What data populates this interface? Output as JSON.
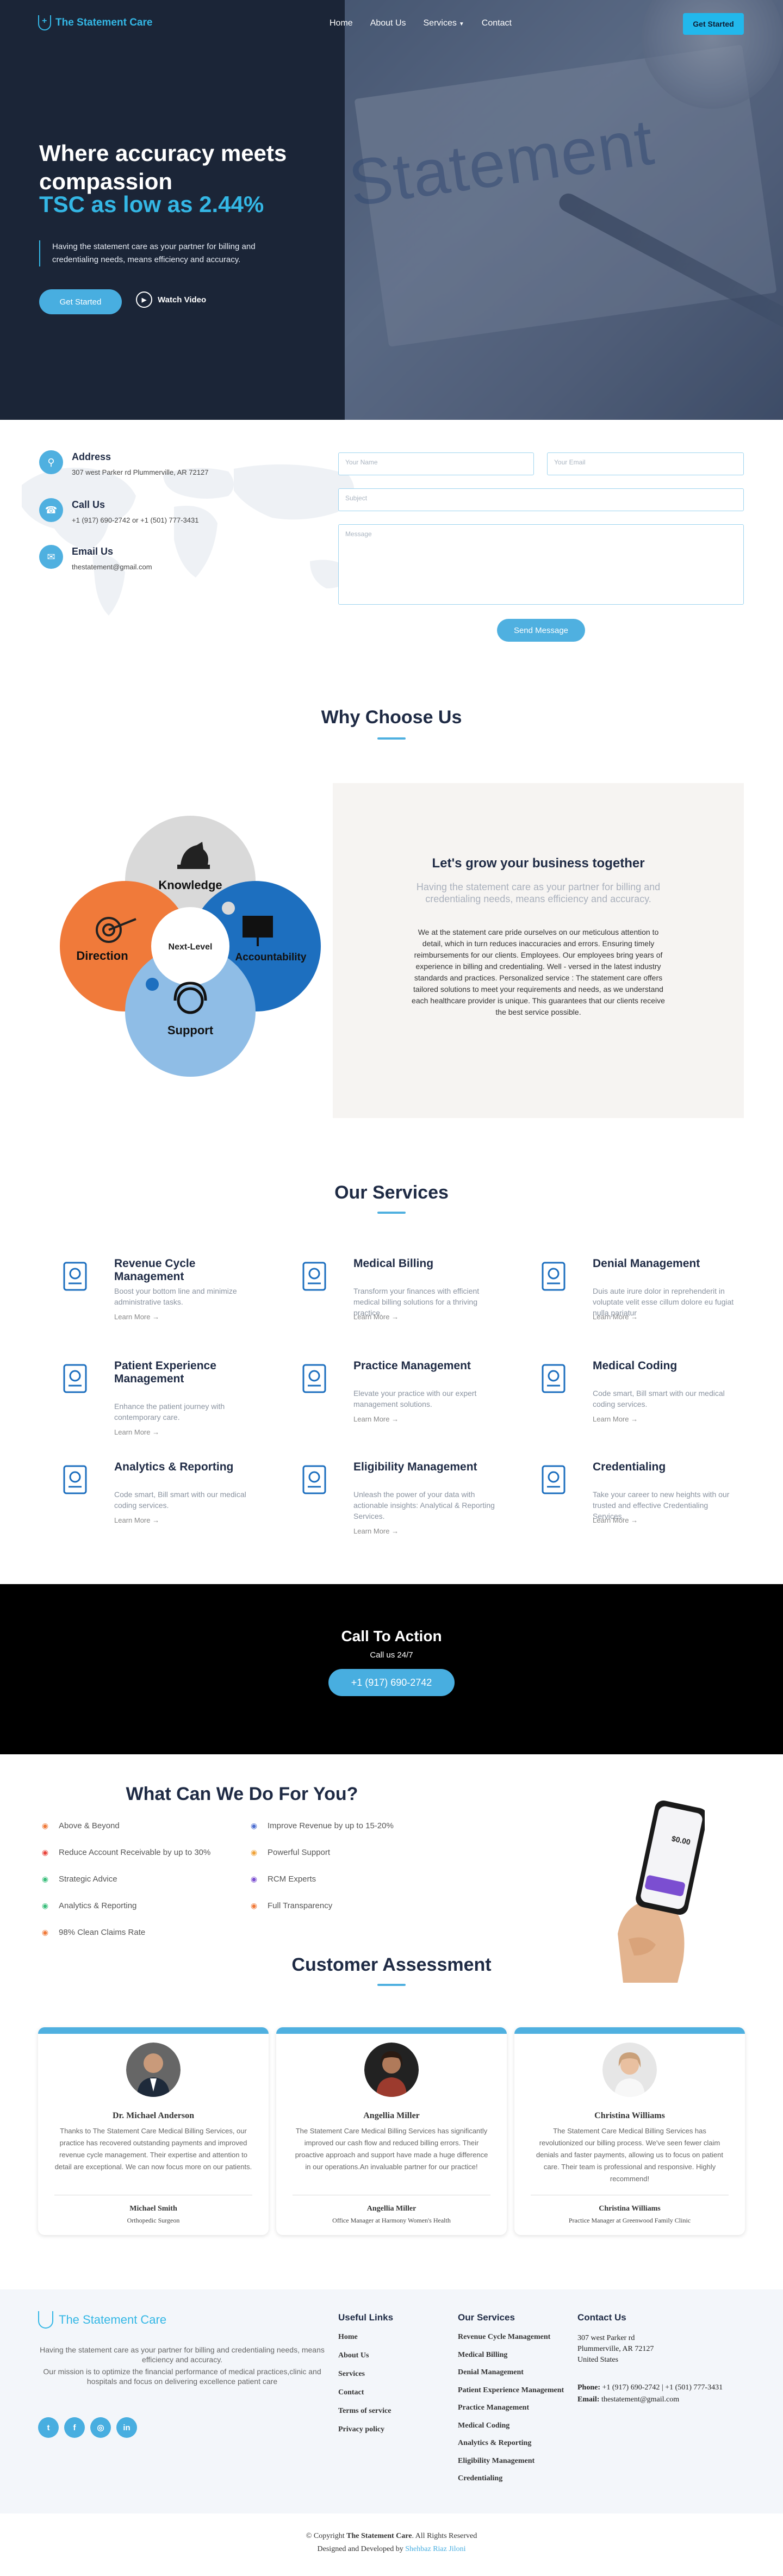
{
  "nav": {
    "logo_text": "The Statement Care",
    "items": [
      "Home",
      "About Us",
      "Services",
      "Contact"
    ],
    "cta": "Get Started"
  },
  "hero": {
    "title": "Where accuracy meets compassion",
    "highlight": "TSC as low as 2.44%",
    "description": "Having the statement care as your partner for billing and credentialing needs, means efficiency and accuracy.",
    "primary_button": "Get Started",
    "video_button": "Watch Video",
    "image_text": "Statement"
  },
  "contact": {
    "address_title": "Address",
    "address": "307 west Parker rd Plummerville, AR 72127",
    "call_title": "Call Us",
    "phones": "+1 (917) 690-2742 or +1 (501) 777-3431",
    "email_title": "Email Us",
    "email": "thestatement@gmail.com",
    "form": {
      "name_placeholder": "Your Name",
      "email_placeholder": "Your Email",
      "subject_placeholder": "Subject",
      "message_placeholder": "Message",
      "submit": "Send Message"
    }
  },
  "why": {
    "title": "Why Choose Us",
    "petals": {
      "top": "Knowledge",
      "left": "Direction",
      "right": "Accountability",
      "bottom": "Support",
      "center": "Next-Level"
    },
    "panel_title": "Let's grow your business together",
    "panel_sub": "Having the statement care as your partner for billing and credentialing needs, means efficiency and accuracy.",
    "panel_text": "We at the statement care pride ourselves on our meticulous attention to detail, which in turn reduces inaccuracies and errors. Ensuring timely reimbursements for our clients. Employees. Our employees bring years of experience in billing and credentialing. Well - versed in the latest industry standards and practices. Personalized service : The statement care offers tailored solutions to meet your requirements and needs, as we understand each healthcare provider is unique. This guarantees that our clients receive the best service possible."
  },
  "services": {
    "title": "Our Services",
    "learn_more": "Learn More",
    "items": [
      {
        "title": "Revenue Cycle Management",
        "desc": "Boost your bottom line and minimize administrative tasks.",
        "icon": "hand-money-icon"
      },
      {
        "title": "Medical Billing",
        "desc": "Transform your finances with efficient medical billing solutions for a thriving practice.",
        "icon": "invoice-icon"
      },
      {
        "title": "Denial Management",
        "desc": "Duis aute irure dolor in reprehenderit in voluptate velit esse cillum dolore eu fugiat nulla pariatur",
        "icon": "denial-hand-icon"
      },
      {
        "title": "Patient Experience Management",
        "desc": "Enhance the patient journey with contemporary care.",
        "icon": "medical-case-icon"
      },
      {
        "title": "Practice Management",
        "desc": "Elevate your practice with our expert management solutions.",
        "icon": "medical-tools-icon"
      },
      {
        "title": "Medical Coding",
        "desc": "Code smart, Bill smart with our medical coding services.",
        "icon": "coding-hand-icon"
      },
      {
        "title": "Analytics & Reporting",
        "desc": "Code smart, Bill smart with our medical coding services.",
        "icon": "bar-chart-icon"
      },
      {
        "title": "Eligibility Management",
        "desc": "Unleash the power of your data with actionable insights: Analytical & Reporting Services.",
        "icon": "people-icon"
      },
      {
        "title": "Credentialing",
        "desc": "Take your career to new heights with our trusted and effective Credentialing Services.",
        "icon": "credential-hand-icon"
      }
    ]
  },
  "cta": {
    "title": "Call To Action",
    "subtitle": "Call us 24/7",
    "button": "+1 (917) 690-2742"
  },
  "what": {
    "title": "What Can We Do For You?",
    "left": [
      {
        "label": "Above & Beyond",
        "icon": "eye-icon",
        "color": "#f07a3a"
      },
      {
        "label": "Reduce Account Receivable by up to 30%",
        "icon": "gauge-icon",
        "color": "#e8453c"
      },
      {
        "label": "Strategic Advice",
        "icon": "target-icon",
        "color": "#3bbf7c"
      },
      {
        "label": "Analytics & Reporting",
        "icon": "chart-icon",
        "color": "#3bbf7c"
      },
      {
        "label": "98% Clean Claims Rate",
        "icon": "pulse-icon",
        "color": "#f07a3a"
      }
    ],
    "right": [
      {
        "label": "Improve Revenue by up to 15-20%",
        "icon": "infinity-icon",
        "color": "#4e6fd1"
      },
      {
        "label": "Powerful Support",
        "icon": "star-icon",
        "color": "#f0a33a"
      },
      {
        "label": "RCM Experts",
        "icon": "expert-icon",
        "color": "#7b4ed1"
      },
      {
        "label": "Full Transparency",
        "icon": "pulse-icon",
        "color": "#f07a3a"
      }
    ],
    "phone_amount": "$0.00"
  },
  "assessment": {
    "title": "Customer Assessment",
    "reviews": [
      {
        "name": "Dr. Michael Anderson",
        "quote": "Thanks to The Statement Care Medical Billing Services, our practice has recovered outstanding payments and improved revenue cycle management. Their expertise and attention to detail are exceptional. We can now focus more on our patients.",
        "author": "Michael Smith",
        "role": "Orthopedic Surgeon"
      },
      {
        "name": "Angellia Miller",
        "quote": "The Statement Care Medical Billing Services has significantly improved our cash flow and reduced billing errors. Their proactive approach and support have made a huge difference in our operations.An invaluable partner for our practice!",
        "author": "Angellia Miller",
        "role": "Office Manager at Harmony Women's Health"
      },
      {
        "name": "Christina Williams",
        "quote": "The Statement Care Medical Billing Services has revolutionized our billing process. We've seen fewer claim denials and faster payments, allowing us to focus on patient care. Their team is professional and responsive. Highly recommend!",
        "author": "Christina Williams",
        "role": "Practice Manager at Greenwood Family Clinic"
      }
    ]
  },
  "footer": {
    "logo_text": "The Statement Care",
    "about": "Having the statement care as your partner for billing and credentialing needs, means efficiency and accuracy.",
    "mission": "Our mission is to optimize the financial performance of medical practices,clinic and hospitals and focus on delivering excellence patient care",
    "useful_title": "Useful Links",
    "useful": [
      "Home",
      "About Us",
      "Services",
      "Contact",
      "Terms of service",
      "Privacy policy"
    ],
    "services_title": "Our Services",
    "services": [
      "Revenue Cycle Management",
      "Medical Billing",
      "Denial Management",
      "Patient Experience Management",
      "Practice Management",
      "Medical Coding",
      "Analytics & Reporting",
      "Eligibility Management",
      "Credentialing"
    ],
    "contact_title": "Contact Us",
    "addr1": "307 west Parker rd",
    "addr2": "Plummerville, AR 72127",
    "addr3": "United States",
    "phone_label": "Phone:",
    "phone": "+1 (917) 690-2742 | +1 (501) 777-3431",
    "email_label": "Email:",
    "email": "thestatement@gmail.com",
    "social": [
      "twitter-icon",
      "facebook-icon",
      "instagram-icon",
      "linkedin-icon"
    ],
    "copy_prefix": "© Copyright",
    "copy_brand": "The Statement Care",
    "copy_suffix": ". All Rights Reserved",
    "dev_prefix": "Designed and Developed by",
    "dev_name": "Shehbaz Riaz Jiloni"
  },
  "colors": {
    "accent": "#4fb0e0",
    "dark": "#1b2537",
    "orange": "#f07a3a",
    "blue": "#1d6fbf",
    "grey": "#d9d9d9",
    "light_blue": "#8fbde6"
  }
}
